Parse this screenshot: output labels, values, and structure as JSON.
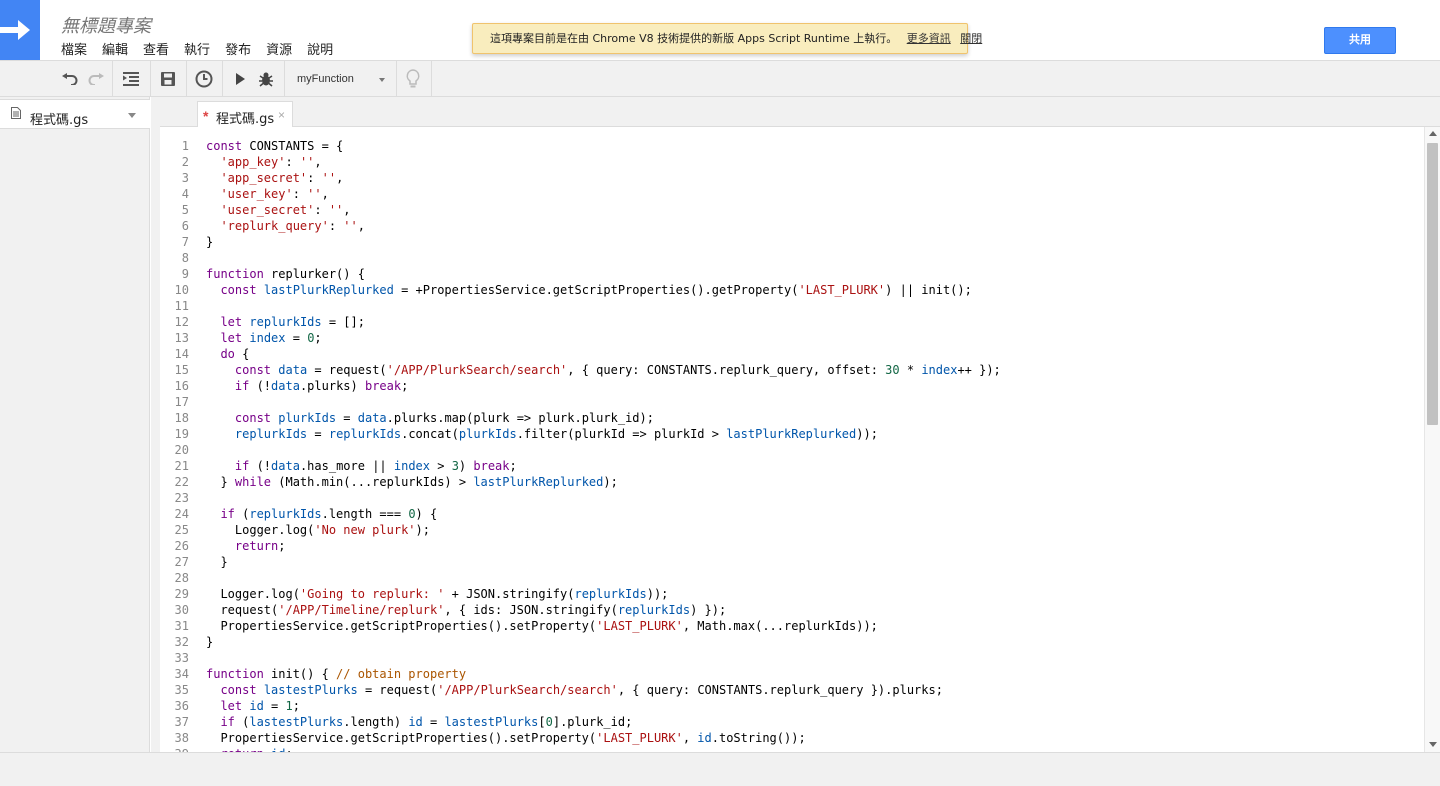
{
  "header": {
    "project_title": "無標題專案",
    "menu": [
      "檔案",
      "編輯",
      "查看",
      "執行",
      "發布",
      "資源",
      "說明"
    ],
    "notice_text": "這項專案目前是在由 Chrome V8 技術提供的新版 Apps Script Runtime 上執行。",
    "notice_more": "更多資訊",
    "notice_dismiss": "關閉",
    "share_label": "共用",
    "accent_color": "#4285f4"
  },
  "toolbar": {
    "function_name": "myFunction",
    "icons": [
      "undo-icon",
      "redo-icon",
      "indent-icon",
      "save-icon",
      "triggers-icon",
      "run-icon",
      "debug-icon",
      "lightbulb-icon"
    ]
  },
  "sidebar": {
    "file_name": "程式碼.gs"
  },
  "editor": {
    "tab_modified": "*",
    "tab_name": "程式碼.gs",
    "tab_close": "×",
    "lines": [
      "const CONSTANTS = {",
      "  'app_key': '',",
      "  'app_secret': '',",
      "  'user_key': '',",
      "  'user_secret': '',",
      "  'replurk_query': '',",
      "}",
      "",
      "function replurker() {",
      "  const lastPlurkReplurked = +PropertiesService.getScriptProperties().getProperty('LAST_PLURK') || init();",
      "",
      "  let replurkIds = [];",
      "  let index = 0;",
      "  do {",
      "    const data = request('/APP/PlurkSearch/search', { query: CONSTANTS.replurk_query, offset: 30 * index++ });",
      "    if (!data.plurks) break;",
      "",
      "    const plurkIds = data.plurks.map(plurk => plurk.plurk_id);",
      "    replurkIds = replurkIds.concat(plurkIds.filter(plurkId => plurkId > lastPlurkReplurked));",
      "",
      "    if (!data.has_more || index > 3) break;",
      "  } while (Math.min(...replurkIds) > lastPlurkReplurked);",
      "",
      "  if (replurkIds.length === 0) {",
      "    Logger.log('No new plurk');",
      "    return;",
      "  }",
      "",
      "  Logger.log('Going to replurk: ' + JSON.stringify(replurkIds));",
      "  request('/APP/Timeline/replurk', { ids: JSON.stringify(replurkIds) });",
      "  PropertiesService.getScriptProperties().setProperty('LAST_PLURK', Math.max(...replurkIds));",
      "}",
      "",
      "function init() { // obtain property",
      "  const lastestPlurks = request('/APP/PlurkSearch/search', { query: CONSTANTS.replurk_query }).plurks;",
      "  let id = 1;",
      "  if (lastestPlurks.length) id = lastestPlurks[0].plurk_id;",
      "  PropertiesService.getScriptProperties().setProperty('LAST_PLURK', id.toString());",
      "  return id;"
    ]
  }
}
